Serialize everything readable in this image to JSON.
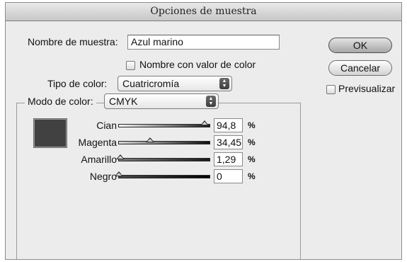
{
  "window": {
    "title": "Opciones de muestra"
  },
  "form": {
    "name_label": "Nombre de muestra:",
    "name_value": "Azul marino",
    "name_with_value_label": "Nombre con valor de color",
    "type_label": "Tipo de color:",
    "type_value": "Cuatricromía",
    "mode_label": "Modo de color:",
    "mode_value": "CMYK"
  },
  "buttons": {
    "ok": "OK",
    "cancel": "Cancelar",
    "preview_label": "Previsualizar"
  },
  "sliders": [
    {
      "label": "Cian",
      "value": "94,8",
      "unit": "%",
      "level": 0.948
    },
    {
      "label": "Magenta",
      "value": "34,45",
      "unit": "%",
      "level": 0.3445
    },
    {
      "label": "Amarillo",
      "value": "1,29",
      "unit": "%",
      "level": 0.0129
    },
    {
      "label": "Negro",
      "value": "0",
      "unit": "%",
      "level": 0
    }
  ],
  "swatch_color": "#414141"
}
